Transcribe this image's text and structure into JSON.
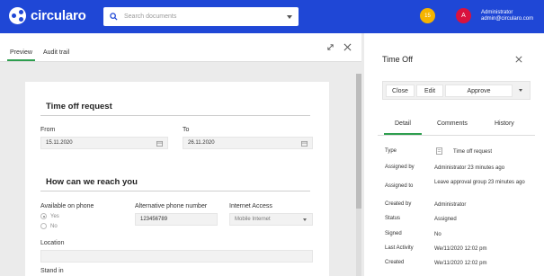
{
  "header": {
    "brand": "circularo",
    "search_placeholder": "Search documents",
    "notification_count": "15",
    "avatar_initial": "A",
    "user_name": "Administrator",
    "user_email": "admin@circularo.com",
    "brand_color": "#1f47d6"
  },
  "left_tabs": [
    "Preview",
    "Audit trail"
  ],
  "form": {
    "section1_title": "Time off request",
    "from_label": "From",
    "from_value": "15.11.2020",
    "to_label": "To",
    "to_value": "26.11.2020",
    "section2_title": "How can we reach you",
    "phone_label": "Available on phone",
    "opt_yes": "Yes",
    "opt_no": "No",
    "selected_option": "Yes",
    "alt_phone_label": "Alternative phone number",
    "alt_phone_value": "123456789",
    "internet_label": "Internet Access",
    "internet_value": "Mobile Internet",
    "location_label": "Location",
    "location_value": "",
    "standin_label": "Stand in"
  },
  "right_panel": {
    "title": "Time Off",
    "close_label": "Close",
    "edit_label": "Edit",
    "approve_label": "Approve",
    "tabs": [
      "Detail",
      "Comments",
      "History"
    ],
    "active_tab": "Detail",
    "details": [
      {
        "label": "Type",
        "value": "Time off request"
      },
      {
        "label": "Assigned by",
        "value": "Administrator 23 minutes ago"
      },
      {
        "label": "Assigned to",
        "value": "Leave approval group 23 minutes ago"
      },
      {
        "label": "Created by",
        "value": "Administrator"
      },
      {
        "label": "Status",
        "value": "Assigned"
      },
      {
        "label": "Signed",
        "value": "No"
      },
      {
        "label": "Last Activity",
        "value": "We/11/2020 12:02 pm"
      },
      {
        "label": "Created",
        "value": "We/11/2020 12:02 pm"
      }
    ]
  },
  "colors": {
    "accent_green": "#2e9e4f",
    "notification_badge": "#f5b400",
    "avatar_bg": "#d9123e"
  }
}
